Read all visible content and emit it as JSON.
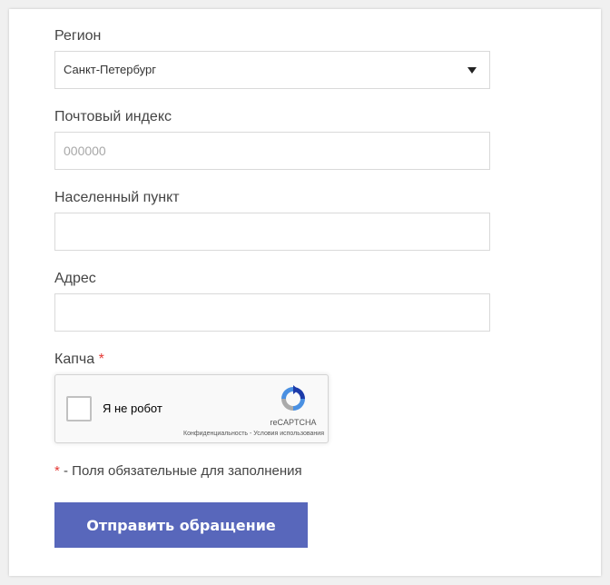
{
  "form": {
    "region": {
      "label": "Регион",
      "value": "Санкт-Петербург"
    },
    "postal": {
      "label": "Почтовый индекс",
      "placeholder": "000000",
      "value": ""
    },
    "city": {
      "label": "Населенный пункт",
      "value": ""
    },
    "address": {
      "label": "Адрес",
      "value": ""
    },
    "captcha": {
      "label": "Капча",
      "required_mark": "*",
      "checkbox_label": "Я не робот",
      "brand": "reCAPTCHA",
      "privacy": "Конфиденциальность",
      "separator": " - ",
      "terms": "Условия использования"
    },
    "required_note": {
      "mark": "*",
      "text": " - Поля обязательные для заполнения"
    },
    "submit_label": "Отправить обращение"
  },
  "colors": {
    "accent": "#5867bb",
    "required": "#e53935",
    "border": "#d9d9d9"
  },
  "icons": {
    "select": "chevron-down-icon",
    "captcha": "recaptcha-icon"
  }
}
